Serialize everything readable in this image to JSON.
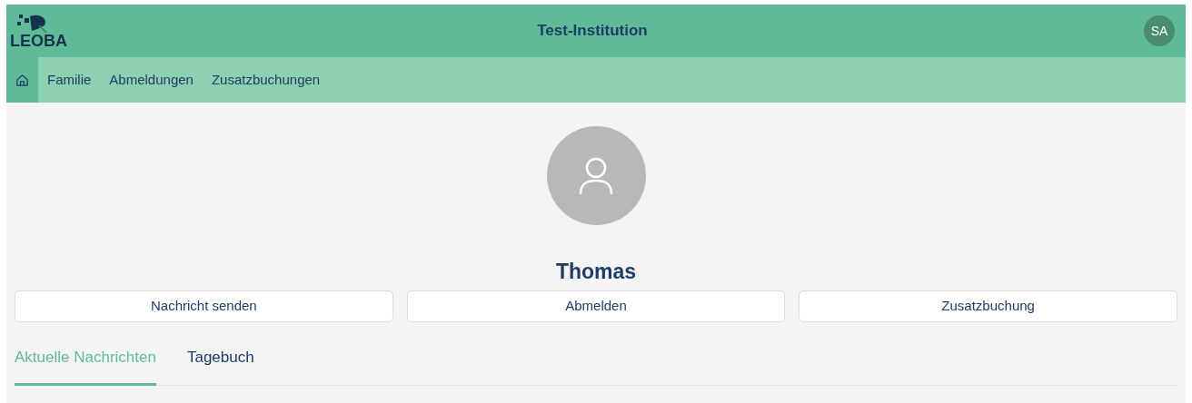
{
  "header": {
    "logo": "LEOBA",
    "title": "Test-Institution",
    "avatar": "SA"
  },
  "nav": [
    {
      "kind": "home",
      "selected": true
    },
    {
      "kind": "link",
      "label": "Familie",
      "selected": false
    },
    {
      "kind": "link",
      "label": "Abmeldungen",
      "selected": false
    },
    {
      "kind": "link",
      "label": "Zusatzbuchungen",
      "selected": false
    }
  ],
  "profile": {
    "name": "Thomas"
  },
  "actions": [
    "Nachricht senden",
    "Abmelden",
    "Zusatzbuchung"
  ],
  "tabs": [
    {
      "label": "Aktuelle Nachrichten",
      "selected": true
    },
    {
      "label": "Tagebuch",
      "selected": false
    }
  ]
}
